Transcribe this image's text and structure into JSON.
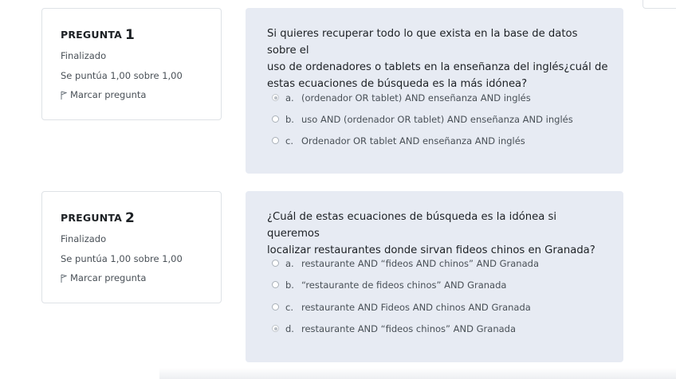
{
  "questions": [
    {
      "label": "PREGUNTA",
      "number": "1",
      "state": "Finalizado",
      "grade": "Se puntúa 1,00 sobre 1,00",
      "flag_label": "Marcar pregunta",
      "text_lines": [
        "Si quieres recuperar todo lo que exista en la base de datos sobre el",
        "uso de ordenadores o tablets en la enseñanza del inglés¿cuál de",
        "estas ecuaciones de búsqueda es la más idónea?"
      ],
      "answers": [
        {
          "letter": "a.",
          "text": "(ordenador OR tablet) AND enseñanza AND inglés",
          "selected": true
        },
        {
          "letter": "b.",
          "text": "uso AND (ordenador OR tablet) AND enseñanza AND inglés",
          "selected": false
        },
        {
          "letter": "c.",
          "text": "Ordenador OR tablet AND enseñanza AND inglés",
          "selected": false
        }
      ]
    },
    {
      "label": "PREGUNTA",
      "number": "2",
      "state": "Finalizado",
      "grade": "Se puntúa 1,00 sobre 1,00",
      "flag_label": "Marcar pregunta",
      "text_lines": [
        "¿Cuál de estas ecuaciones de búsqueda es la idónea si queremos",
        "localizar restaurantes donde sirvan fideos chinos en Granada?"
      ],
      "answers": [
        {
          "letter": "a.",
          "text": "restaurante AND “fideos AND chinos” AND Granada",
          "selected": false
        },
        {
          "letter": "b.",
          "text": "“restaurante de fideos chinos” AND Granada",
          "selected": false
        },
        {
          "letter": "c.",
          "text": "restaurante AND Fideos AND chinos AND Granada",
          "selected": false
        },
        {
          "letter": "d.",
          "text": "restaurante AND “fideos chinos” AND Granada",
          "selected": true
        }
      ]
    }
  ]
}
